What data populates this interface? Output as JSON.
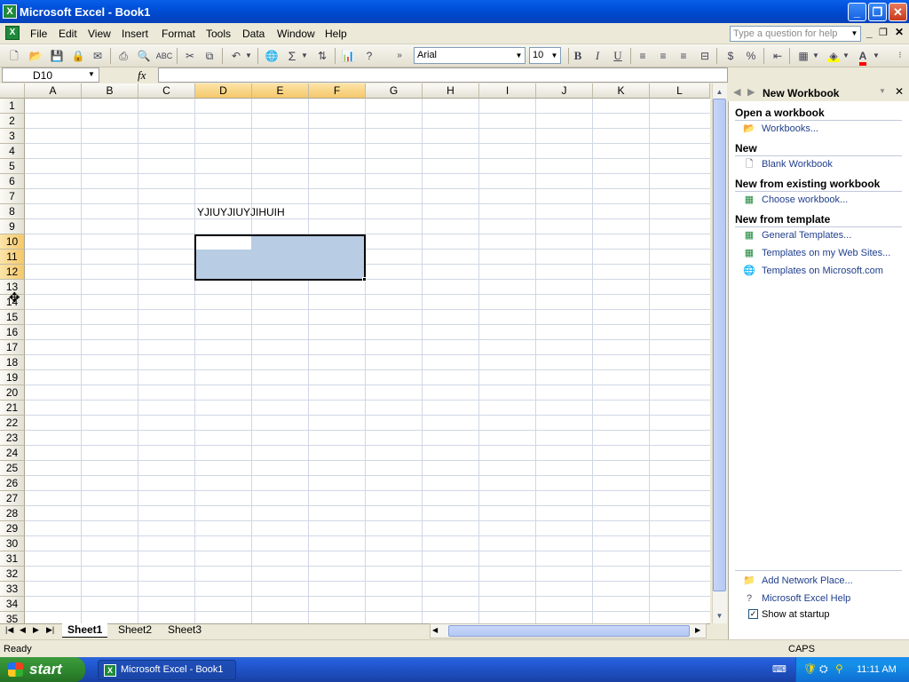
{
  "window": {
    "title": "Microsoft Excel - Book1",
    "icon": "excel-icon"
  },
  "menus": [
    "File",
    "Edit",
    "View",
    "Insert",
    "Format",
    "Tools",
    "Data",
    "Window",
    "Help"
  ],
  "help_box": {
    "placeholder": "Type a question for help"
  },
  "toolbar": {
    "font": "Arial",
    "size": "10",
    "bold": "B",
    "italic": "I",
    "underline": "U",
    "autosum": "Σ",
    "fill_color": "#ffff00",
    "font_color": "#ff0000"
  },
  "formula_bar": {
    "name_box": "D10",
    "fx": "fx",
    "value": ""
  },
  "columns": [
    "A",
    "B",
    "C",
    "D",
    "E",
    "F",
    "G",
    "H",
    "I",
    "J",
    "K",
    "L"
  ],
  "rows": [
    "1",
    "2",
    "3",
    "4",
    "5",
    "6",
    "7",
    "8",
    "9",
    "10",
    "11",
    "12",
    "13",
    "14",
    "15",
    "16",
    "17",
    "18",
    "19",
    "20",
    "21",
    "22",
    "23",
    "24",
    "25",
    "26",
    "27",
    "28",
    "29",
    "30",
    "31",
    "32",
    "33",
    "34",
    "35"
  ],
  "cells": {
    "D8": "YJIUYJIUYJIHUIH"
  },
  "selection": {
    "range": "D10:F12",
    "active_cell": "D10"
  },
  "sheets": [
    "Sheet1",
    "Sheet2",
    "Sheet3"
  ],
  "active_sheet": "Sheet1",
  "status": {
    "left": "Ready",
    "caps": "CAPS"
  },
  "task_pane": {
    "title": "New Workbook",
    "sections": [
      {
        "heading": "Open a workbook",
        "items": [
          {
            "label": "Workbooks...",
            "icon": "folder-open-icon"
          }
        ]
      },
      {
        "heading": "New",
        "items": [
          {
            "label": "Blank Workbook",
            "icon": "blank-document-icon"
          }
        ]
      },
      {
        "heading": "New from existing workbook",
        "items": [
          {
            "label": "Choose workbook...",
            "icon": "workbook-icon"
          }
        ]
      },
      {
        "heading": "New from template",
        "items": [
          {
            "label": "General Templates...",
            "icon": "templates-icon"
          },
          {
            "label": "Templates on my Web Sites...",
            "icon": "web-templates-icon"
          },
          {
            "label": "Templates on Microsoft.com",
            "icon": "globe-icon"
          }
        ]
      }
    ],
    "footer": [
      {
        "label": "Add Network Place...",
        "icon": "network-place-icon"
      },
      {
        "label": "Microsoft Excel Help",
        "icon": "help-icon"
      }
    ],
    "show_at_startup": {
      "label": "Show at startup",
      "checked": true
    }
  },
  "taskbar": {
    "start": "start",
    "task": "Microsoft Excel - Book1",
    "clock": "11:11 AM"
  }
}
